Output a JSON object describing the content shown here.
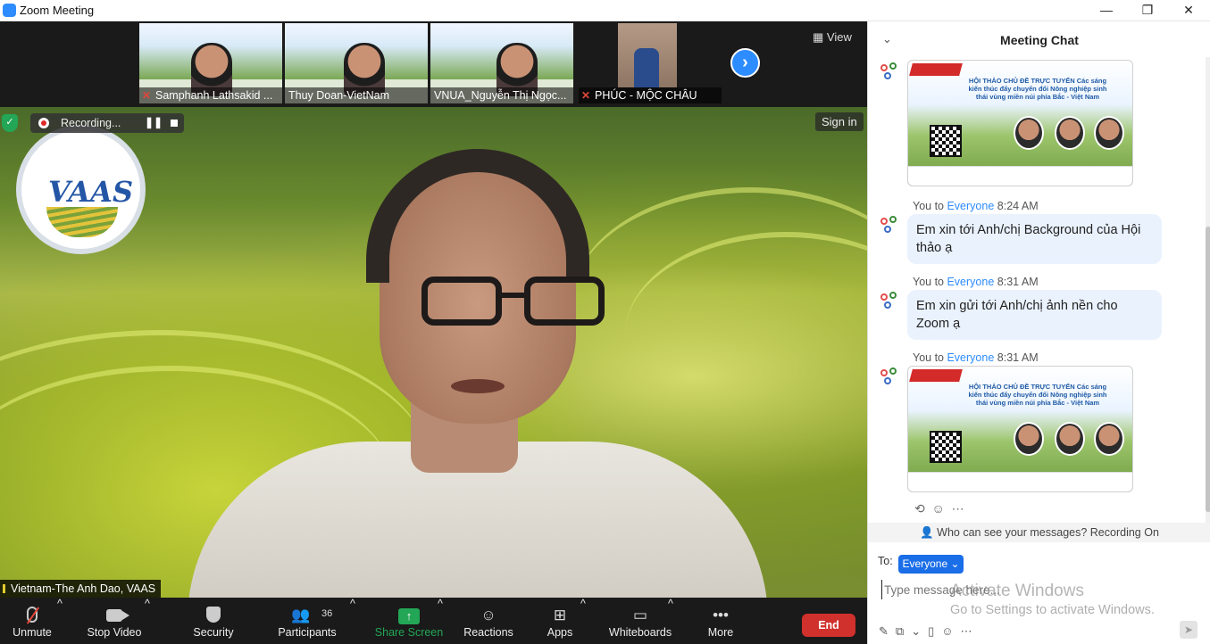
{
  "window": {
    "title": "Zoom Meeting",
    "minimize": "—",
    "restore": "❐",
    "close": "✕"
  },
  "strip": {
    "view_label": "View",
    "participants": [
      {
        "name": "Samphanh Lathsakid ...",
        "muted": true
      },
      {
        "name": "Thuy Doan-VietNam",
        "muted": false
      },
      {
        "name": "VNUA_Nguyễn Thị Ngọc...",
        "muted": false
      },
      {
        "name": "PHÚC - MỘC CHÂU",
        "muted": true
      }
    ]
  },
  "speaker": {
    "name": "Vietnam-The Anh Dao, VAAS",
    "logo_text": "VAAS",
    "recording_label": "Recording...",
    "sign_in_label": "Sign in"
  },
  "toolbar": {
    "unmute": "Unmute",
    "stop_video": "Stop Video",
    "security": "Security",
    "participants": "Participants",
    "participants_count": "36",
    "share_screen": "Share Screen",
    "reactions": "Reactions",
    "apps": "Apps",
    "whiteboards": "Whiteboards",
    "more": "More",
    "end": "End"
  },
  "chat": {
    "title": "Meeting Chat",
    "image_title": "HỘI THẢO CHỦ ĐỀ TRỰC TUYẾN\nCác sáng kiến thúc đẩy chuyển đổi Nông nghiệp sinh thái vùng miền núi phía Bắc - Việt Nam",
    "messages": [
      {
        "from": "You to ",
        "to": "Everyone",
        "time": "8:24 AM",
        "text": "Em xin tới Anh/chị Background của Hội thảo ạ"
      },
      {
        "from": "You to ",
        "to": "Everyone",
        "time": "8:31 AM",
        "text": "Em xin gửi tới Anh/chị ảnh nền cho Zoom ạ"
      },
      {
        "from": "You to ",
        "to": "Everyone",
        "time": "8:31 AM",
        "text": ""
      }
    ],
    "privacy_notice": "Who can see your messages? Recording On",
    "to_label": "To:",
    "recipient": "Everyone",
    "input_placeholder": "Type message here...",
    "watermark_title": "Activate Windows",
    "watermark_sub": "Go to Settings to activate Windows."
  }
}
